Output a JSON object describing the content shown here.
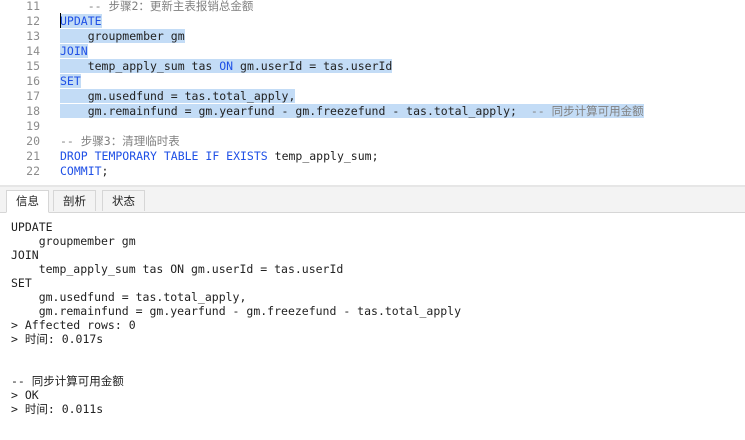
{
  "editor": {
    "lines": [
      {
        "n": "11",
        "segs": [
          {
            "t": "    -- 步骤2：更新主表报销总金额",
            "c": "cm"
          }
        ]
      },
      {
        "n": "12",
        "segs": [
          {
            "t": "UPDATE",
            "c": "kw",
            "s": 1
          }
        ]
      },
      {
        "n": "13",
        "segs": [
          {
            "t": "    groupmember gm",
            "s": 1
          }
        ]
      },
      {
        "n": "14",
        "segs": [
          {
            "t": "JOIN",
            "c": "kw",
            "s": 1
          }
        ]
      },
      {
        "n": "15",
        "segs": [
          {
            "t": "    temp_apply_sum tas ",
            "s": 1
          },
          {
            "t": "ON",
            "c": "kw",
            "s": 1
          },
          {
            "t": " gm.userId = tas.userId",
            "s": 1
          }
        ]
      },
      {
        "n": "16",
        "segs": [
          {
            "t": "SET",
            "c": "kw",
            "s": 1
          }
        ]
      },
      {
        "n": "17",
        "segs": [
          {
            "t": "    gm.usedfund = tas.total_apply,",
            "s": 1
          }
        ]
      },
      {
        "n": "18",
        "segs": [
          {
            "t": "    gm.remainfund = gm.yearfund - gm.freezefund - tas.total_apply;  ",
            "s": 1
          },
          {
            "t": "-- 同步计算可用金额",
            "c": "cm",
            "s": 1
          }
        ]
      },
      {
        "n": "19",
        "segs": [
          {
            "t": ""
          }
        ]
      },
      {
        "n": "20",
        "segs": [
          {
            "t": "-- 步骤3：清理临时表",
            "c": "cm"
          }
        ]
      },
      {
        "n": "21",
        "segs": [
          {
            "t": "DROP TEMPORARY TABLE IF EXISTS",
            "c": "kw"
          },
          {
            "t": " temp_apply_sum;"
          }
        ]
      },
      {
        "n": "22",
        "segs": [
          {
            "t": "COMMIT",
            "c": "kw"
          },
          {
            "t": ";"
          }
        ]
      }
    ]
  },
  "tabs": [
    {
      "label": "信息",
      "active": true
    },
    {
      "label": "剖析",
      "active": false
    },
    {
      "label": "状态",
      "active": false
    }
  ],
  "output": {
    "lines": [
      "UPDATE",
      "    groupmember gm",
      "JOIN",
      "    temp_apply_sum tas ON gm.userId = tas.userId",
      "SET",
      "    gm.usedfund = tas.total_apply,",
      "    gm.remainfund = gm.yearfund - gm.freezefund - tas.total_apply",
      "> Affected rows: 0",
      "> 时间: 0.017s",
      "",
      "",
      "-- 同步计算可用金额",
      "> OK",
      "> 时间: 0.011s"
    ]
  }
}
